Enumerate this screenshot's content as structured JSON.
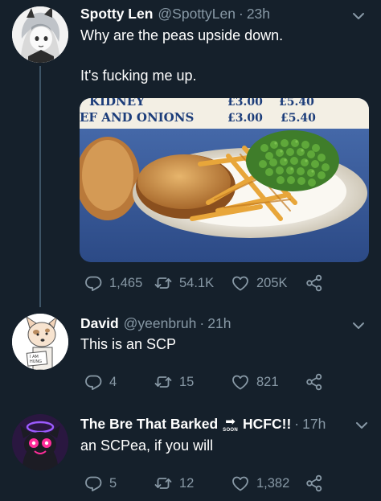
{
  "tweets": [
    {
      "author": "Spotty Len",
      "handle": "@SpottyLen",
      "separator": "·",
      "time": "23h",
      "text_line1": "Why are the peas upside down.",
      "text_line2": "It's fucking me up.",
      "image": {
        "menu_line1_left": "KIDNEY",
        "menu_line1_price1": "£3.00",
        "menu_line1_price2": "£5.40",
        "menu_line2_left": "EF AND ONIONS",
        "menu_line2_price1": "£3.00",
        "menu_line2_price2": "£5.40"
      },
      "replies": "1,465",
      "retweets": "54.1K",
      "likes": "205K"
    },
    {
      "author": "David",
      "handle": "@yeenbruh",
      "separator": "·",
      "time": "21h",
      "text": "This is an SCP",
      "avatar_sign_line1": "I AM",
      "avatar_sign_line2": "HUNG",
      "replies": "4",
      "retweets": "15",
      "likes": "821"
    },
    {
      "author": "The Bre That Barked",
      "author_arrow": "➡",
      "author_soon": "SOON",
      "author_suffix": "HCFC!!",
      "separator": "·",
      "time": "17h",
      "text": "an SCPea, if you will",
      "replies": "5",
      "retweets": "12",
      "likes": "1,382"
    }
  ],
  "colors": {
    "background": "#15202b",
    "secondary_text": "#8899a6",
    "thread_line": "#3d5466"
  },
  "icons": [
    "reply-icon",
    "retweet-icon",
    "like-icon",
    "share-icon",
    "chevron-down-icon"
  ]
}
